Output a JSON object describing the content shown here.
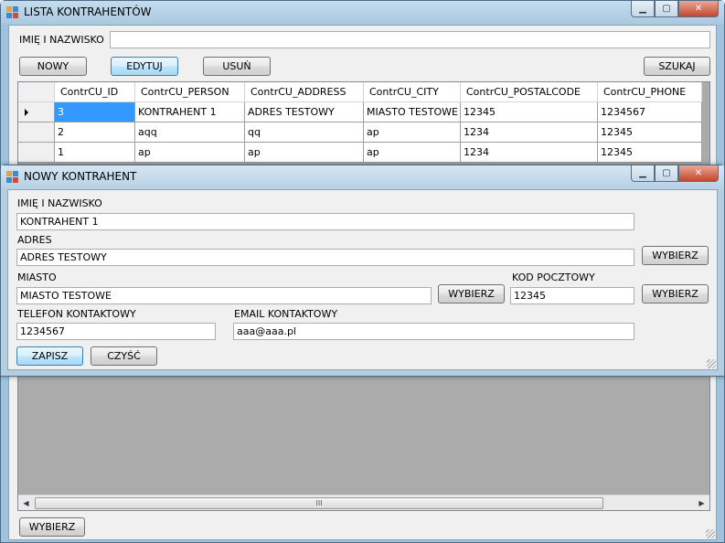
{
  "main_window": {
    "title": "LISTA KONTRAHENTÓW",
    "search_label": "IMIĘ I NAZWISKO",
    "search_value": "",
    "buttons": {
      "new": "NOWY",
      "edit": "EDYTUJ",
      "delete": "USUŃ",
      "search": "SZUKAJ",
      "select": "WYBIERZ"
    },
    "grid": {
      "columns": [
        "ContrCU_ID",
        "ContrCU_PERSON",
        "ContrCU_ADDRESS",
        "ContrCU_CITY",
        "ContrCU_POSTALCODE",
        "ContrCU_PHONE"
      ],
      "rows": [
        [
          "3",
          "KONTRAHENT 1",
          "ADRES TESTOWY",
          "MIASTO TESTOWE",
          "12345",
          "1234567"
        ],
        [
          "2",
          "aqq",
          "qq",
          "ap",
          "1234",
          "12345"
        ],
        [
          "1",
          "ap",
          "ap",
          "ap",
          "1234",
          "12345"
        ]
      ],
      "scroll_grip": "III"
    }
  },
  "dialog": {
    "title": "NOWY KONTRAHENT",
    "name_label": "IMIĘ I NAZWISKO",
    "name_value": "KONTRAHENT 1",
    "address_label": "ADRES",
    "address_value": "ADRES TESTOWY",
    "city_label": "MIASTO",
    "city_value": "MIASTO TESTOWE",
    "postal_label": "KOD POCZTOWY",
    "postal_value": "12345",
    "phone_label": "TELEFON KONTAKTOWY",
    "phone_value": "1234567",
    "email_label": "EMAIL KONTAKTOWY",
    "email_value": "aaa@aaa.pl",
    "buttons": {
      "choose": "WYBIERZ",
      "save": "ZAPISZ",
      "clear": "CZYŚĆ"
    }
  },
  "window_controls": {
    "minimize": "▁",
    "maximize": "▢",
    "close": "✕"
  }
}
